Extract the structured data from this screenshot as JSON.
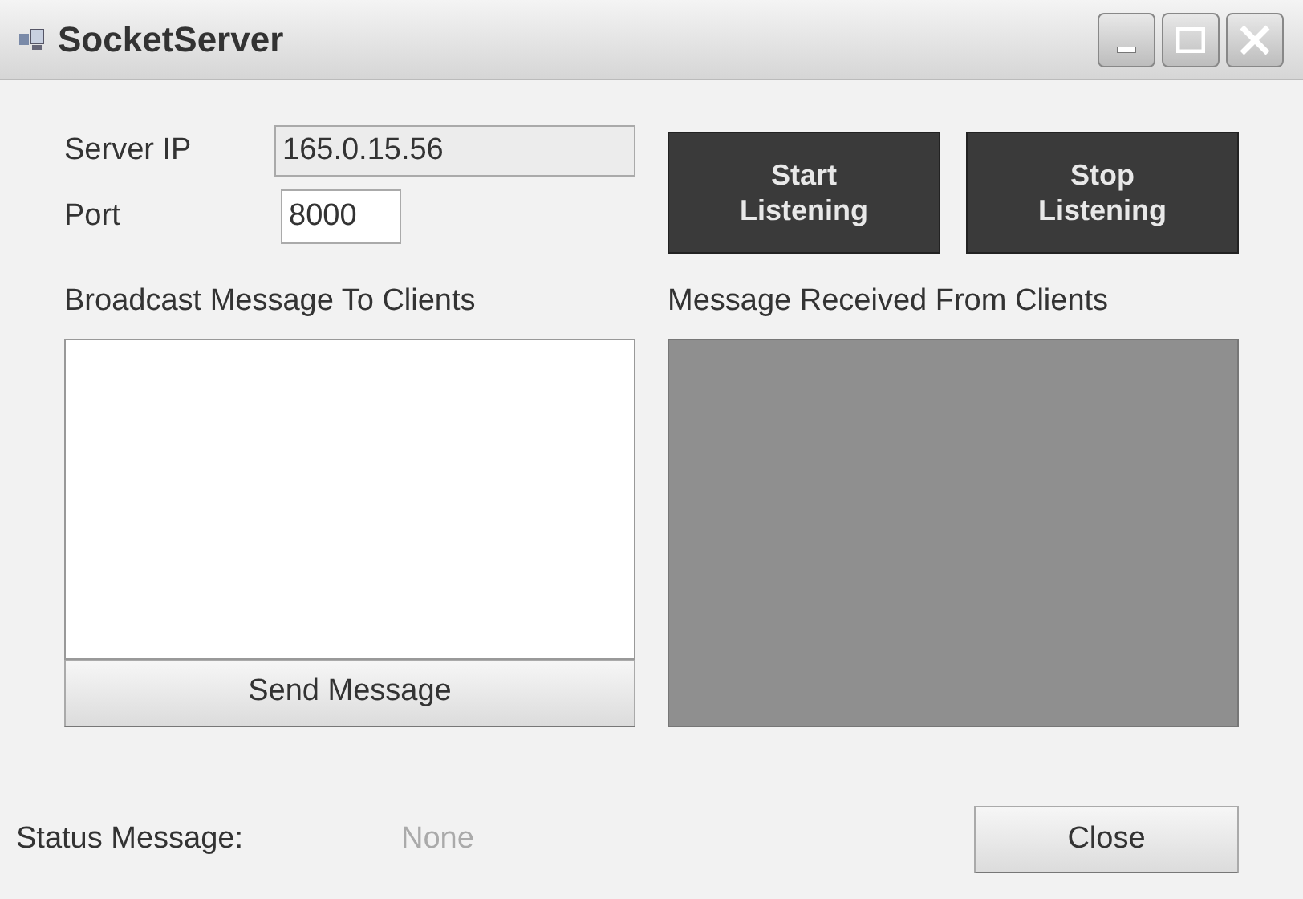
{
  "window": {
    "title": "SocketServer"
  },
  "server_ip": {
    "label": "Server IP",
    "value": "165.0.15.56"
  },
  "port": {
    "label": "Port",
    "value": "8000"
  },
  "listen_buttons": [
    "Start Listening",
    "Stop Listening"
  ],
  "broadcast": {
    "label": "Broadcast Message To Clients",
    "button": "Send Message"
  },
  "received": {
    "label": "Message Received From Clients"
  },
  "status": {
    "label": "Status Message:",
    "value": "None"
  },
  "close_button": "Close"
}
